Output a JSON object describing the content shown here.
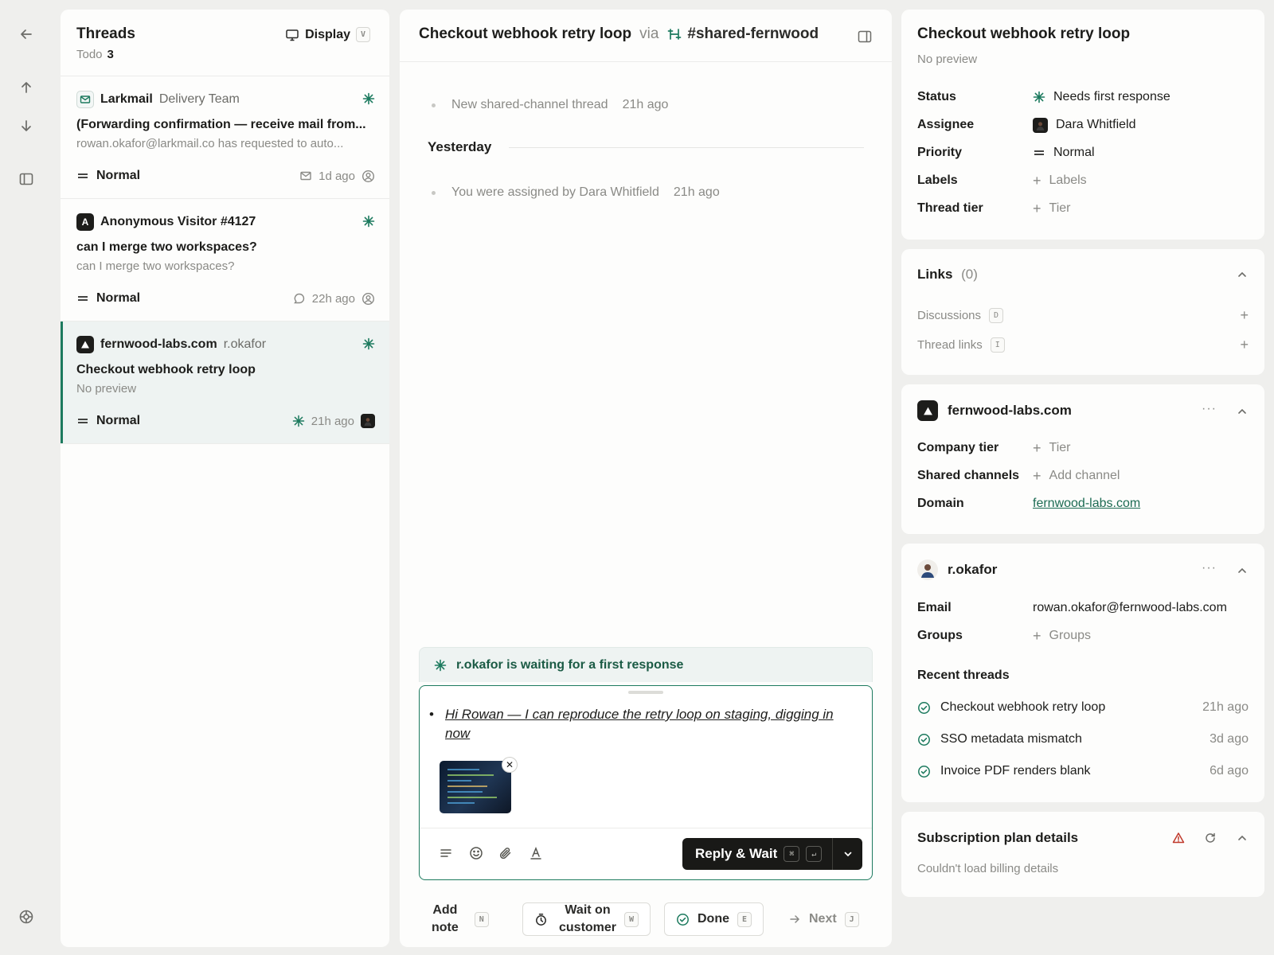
{
  "rail": {
    "back": "arrow-left-icon",
    "up": "arrow-up-icon",
    "down": "arrow-down-icon",
    "sidebar": "sidebar-icon",
    "help": "lifebuoy-icon"
  },
  "threads": {
    "title": "Threads",
    "filter_label": "Todo",
    "filter_count": "3",
    "display_label": "Display",
    "display_key": "V",
    "items": [
      {
        "name": "Larkmail",
        "team": "Delivery Team",
        "subject": "(Forwarding confirmation — receive mail from...",
        "preview": "rowan.okafor@larkmail.co has requested to auto...",
        "priority": "Normal",
        "time": "1d ago"
      },
      {
        "name": "Anonymous Visitor #4127",
        "avatar_letter": "A",
        "team": "",
        "subject": "can I merge two workspaces?",
        "preview": "can I merge two workspaces?",
        "priority": "Normal",
        "time": "22h ago"
      },
      {
        "name": "fernwood-labs.com",
        "team": "r.okafor",
        "subject": "Checkout webhook retry loop",
        "preview": "No preview",
        "priority": "Normal",
        "time": "21h ago"
      }
    ]
  },
  "conversation": {
    "title": "Checkout webhook retry loop",
    "via": "via",
    "channel": "#shared-fernwood",
    "events": [
      {
        "text": "New shared-channel thread",
        "time": "21h ago"
      },
      {
        "text": "You were assigned by Dara Whitfield",
        "time": "21h ago"
      }
    ],
    "day_label": "Yesterday",
    "waiting_text": "r.okafor is waiting for a first response",
    "draft": "Hi Rowan — I can reproduce the retry loop on staging, digging in now",
    "reply_label": "Reply & Wait",
    "reply_key1": "⌘",
    "reply_key2": "↵",
    "actions": {
      "add_note_1": "Add",
      "add_note_2": "note",
      "add_note_key": "N",
      "wait_1": "Wait on",
      "wait_2": "customer",
      "wait_key": "W",
      "done": "Done",
      "done_key": "E",
      "next": "Next",
      "next_key": "J"
    }
  },
  "details": {
    "title": "Checkout webhook retry loop",
    "preview": "No preview",
    "fields": {
      "status_label": "Status",
      "status_value": "Needs first response",
      "assignee_label": "Assignee",
      "assignee_value": "Dara Whitfield",
      "priority_label": "Priority",
      "priority_value": "Normal",
      "labels_label": "Labels",
      "labels_value": "Labels",
      "tier_label": "Thread tier",
      "tier_value": "Tier"
    }
  },
  "links": {
    "title": "Links",
    "count": "(0)",
    "discussions": "Discussions",
    "discussions_key": "D",
    "thread_links": "Thread links",
    "thread_links_key": "I"
  },
  "company": {
    "name": "fernwood-labs.com",
    "tier_label": "Company tier",
    "tier_value": "Tier",
    "channels_label": "Shared channels",
    "channels_value": "Add channel",
    "domain_label": "Domain",
    "domain_value": "fernwood-labs.com"
  },
  "customer": {
    "name": "r.okafor",
    "email_label": "Email",
    "email_value": "rowan.okafor@fernwood-labs.com",
    "groups_label": "Groups",
    "groups_value": "Groups",
    "recent_title": "Recent threads",
    "recent": [
      {
        "title": "Checkout webhook retry loop",
        "time": "21h ago"
      },
      {
        "title": "SSO metadata mismatch",
        "time": "3d ago"
      },
      {
        "title": "Invoice PDF renders blank",
        "time": "6d ago"
      }
    ]
  },
  "subscription": {
    "title": "Subscription plan details",
    "error": "Couldn't load billing details"
  },
  "colors": {
    "accent": "#1c7a5e",
    "active_bg": "#eef3f2",
    "dark_button": "#191917",
    "warning": "#c0392b"
  }
}
